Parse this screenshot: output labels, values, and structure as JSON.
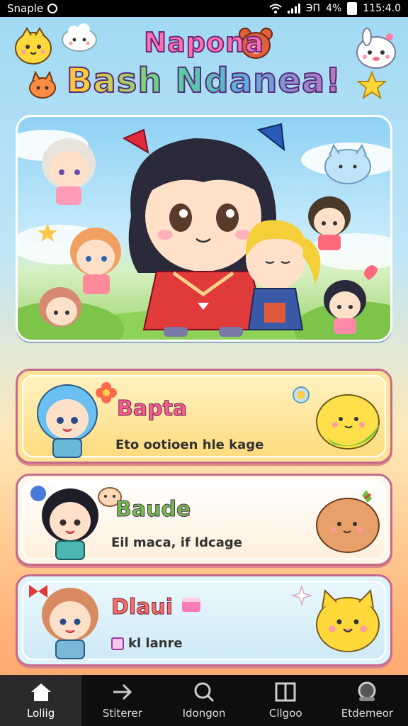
{
  "status_bar": {
    "carrier": "Snaple",
    "signal_text": "ЭΠ",
    "battery": "4%",
    "time": "115:4.0"
  },
  "header": {
    "title_line1": "Napona",
    "title_line2": "Bash Ndanea!"
  },
  "cards": [
    {
      "title": "Bapta",
      "subtitle": "Eto ootioen hle kage",
      "title_color": "#ff5a8a",
      "bg": "#ffe49a"
    },
    {
      "title": "Baude",
      "subtitle": "Eil maca, if ldcage",
      "title_color": "#6cc04a",
      "bg": "#fff7ea"
    },
    {
      "title": "Dlaui",
      "subtitle": "kl lanre",
      "title_color": "#ff6a5a",
      "bg": "#dff3fb"
    }
  ],
  "nav": [
    {
      "label": "Loliig",
      "icon": "home-icon",
      "active": true
    },
    {
      "label": "Stiterer",
      "icon": "arrow-icon",
      "active": false
    },
    {
      "label": "Idongon",
      "icon": "search-icon",
      "active": false
    },
    {
      "label": "Cllgoo",
      "icon": "book-icon",
      "active": false
    },
    {
      "label": "Etdemeor",
      "icon": "profile-icon",
      "active": false
    }
  ],
  "colors": {
    "accent_pink": "#ff6fb1",
    "nav_bg": "#0e0e0e",
    "card_border": "#c66a8a"
  }
}
